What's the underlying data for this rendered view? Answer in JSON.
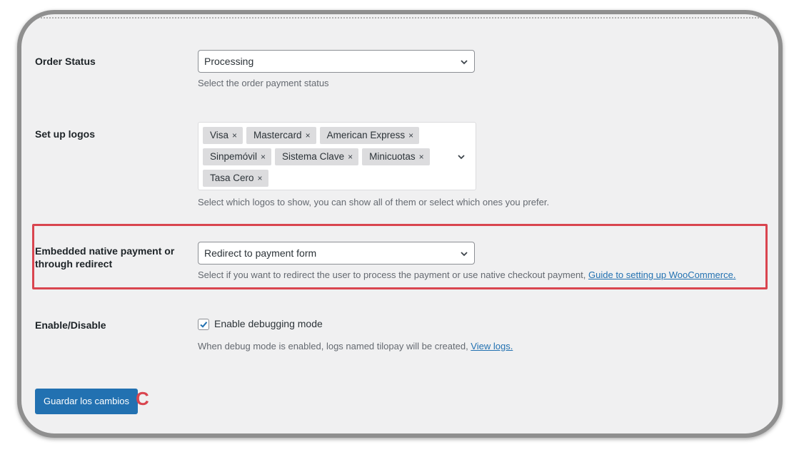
{
  "order_status": {
    "label": "Order Status",
    "selected": "Processing",
    "description": "Select the order payment status"
  },
  "logos": {
    "label": "Set up logos",
    "chips": [
      "Visa",
      "Mastercard",
      "American Express",
      "Sinpemóvil",
      "Sistema Clave",
      "Minicuotas",
      "Tasa Cero"
    ],
    "remove_glyph": "×",
    "description": "Select which logos to show, you can show all of them or select which ones you prefer."
  },
  "payment_mode": {
    "label_line1": "Embedded native payment or",
    "label_line2": "through redirect",
    "selected": "Redirect to payment form",
    "description": "Select if you want to redirect the user to process the payment or use native checkout payment, ",
    "link": "Guide to setting up WooCommerce."
  },
  "debug": {
    "label": "Enable/Disable",
    "checkbox_label": "Enable debugging mode",
    "checked": true,
    "description": "When debug mode is enabled, logs named tilopay will be created, ",
    "link": "View logs."
  },
  "save_button": "Guardar los cambios",
  "annotation_marker": "C",
  "colors": {
    "primary": "#2271b1",
    "highlight": "#d9454f",
    "background": "#f0f0f1"
  }
}
